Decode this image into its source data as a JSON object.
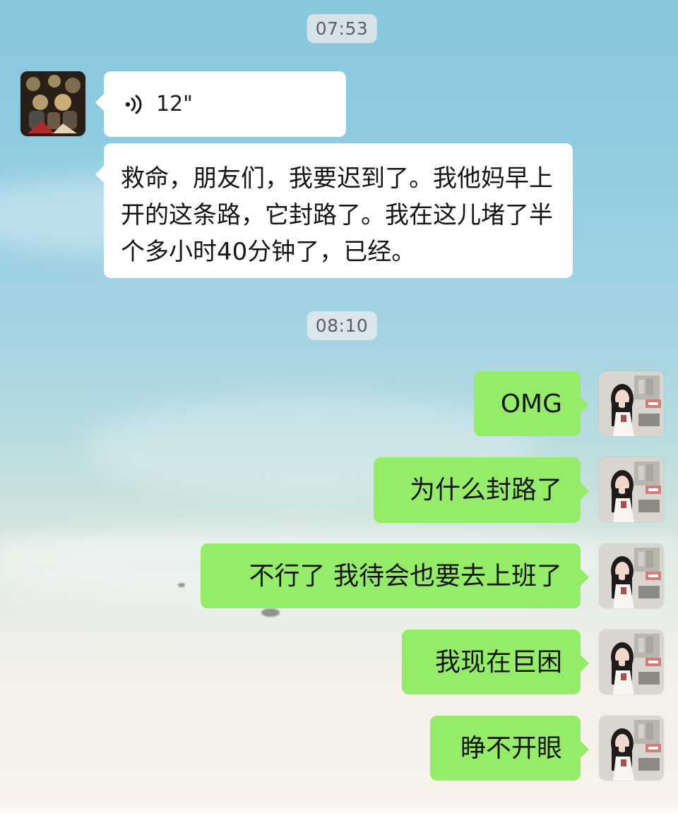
{
  "timestamps": [
    "07:53",
    "08:10"
  ],
  "incoming": {
    "voice_message": {
      "duration": "12\"",
      "icon": "voice-icon"
    },
    "text_message": "救命，朋友们，我要迟到了。我他妈早上开的这条路，它封路了。我在这儿堵了半个多小时40分钟了，已经。"
  },
  "outgoing_messages": [
    "OMG",
    "为什么封路了",
    "不行了 我待会也要去上班了",
    "我现在巨困",
    "睁不开眼"
  ],
  "colors": {
    "incoming_bubble": "#ffffff",
    "outgoing_bubble": "#95ec69",
    "timestamp_bg": "#e5eaec"
  }
}
